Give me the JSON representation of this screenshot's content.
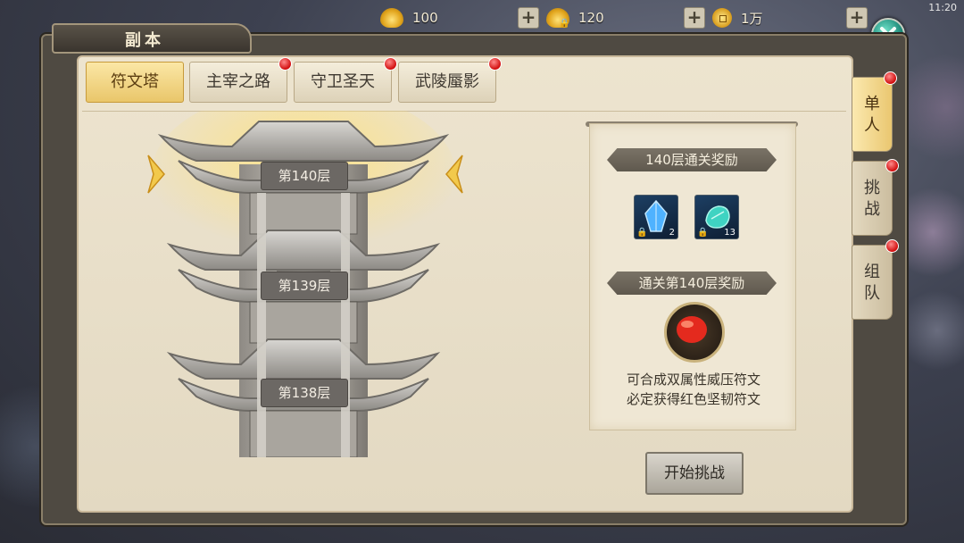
{
  "window": {
    "title": "副本",
    "clock": "11:20"
  },
  "resources": [
    {
      "name": "gold-ingot",
      "value": "100"
    },
    {
      "name": "bound-gold-ingot",
      "value": "120"
    },
    {
      "name": "copper-coin",
      "value": "1万"
    }
  ],
  "tabs": [
    {
      "label": "符文塔",
      "active": true,
      "badge": false
    },
    {
      "label": "主宰之路",
      "active": false,
      "badge": true
    },
    {
      "label": "守卫圣天",
      "active": false,
      "badge": true
    },
    {
      "label": "武陵蜃影",
      "active": false,
      "badge": true
    }
  ],
  "side_tabs": [
    {
      "label": [
        "单",
        "人"
      ],
      "active": true
    },
    {
      "label": [
        "挑",
        "战"
      ],
      "active": false
    },
    {
      "label": [
        "组",
        "队"
      ],
      "active": false
    }
  ],
  "tower": {
    "floors": [
      "第140层",
      "第139层",
      "第138层"
    ]
  },
  "rewards": {
    "clear_title": "140层通关奖励",
    "items": [
      {
        "name": "blue-rune-crystal-icon",
        "count": "2"
      },
      {
        "name": "teal-rune-crystal-icon",
        "count": "13"
      }
    ],
    "floor_title": "通关第140层奖励",
    "floor_item": "red-rune-icon",
    "desc_line1": "可合成双属性威压符文",
    "desc_line2": "必定获得红色坚韧符文"
  },
  "actions": {
    "start": "开始挑战"
  },
  "colors": {
    "accent_gold": "#e9c66a",
    "badge_red": "#d10d0d",
    "close_teal": "#1e8a78"
  }
}
